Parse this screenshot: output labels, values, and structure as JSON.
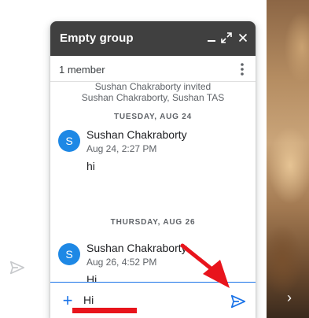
{
  "header": {
    "title": "Empty group"
  },
  "members_bar": {
    "label": "1 member"
  },
  "messages": {
    "system": {
      "line1": "Sushan Chakraborty invited",
      "line2": "Sushan Chakraborty, Sushan TAS"
    },
    "groups": [
      {
        "date": "TUESDAY, AUG 24",
        "sender": "Sushan Chakraborty",
        "avatar_initial": "S",
        "time": "Aug 24, 2:27 PM",
        "text": "hi"
      },
      {
        "date": "THURSDAY, AUG 26",
        "sender": "Sushan Chakraborty",
        "avatar_initial": "S",
        "time": "Aug 26, 4:52 PM",
        "text": "Hi"
      }
    ]
  },
  "composer": {
    "input_value": "Hi",
    "add_icon": "plus-icon",
    "send_icon": "send-icon"
  },
  "colors": {
    "header_bg": "#404040",
    "accent": "#1a73e8",
    "avatar": "#1e88e5",
    "annotation": "#e8141c"
  }
}
